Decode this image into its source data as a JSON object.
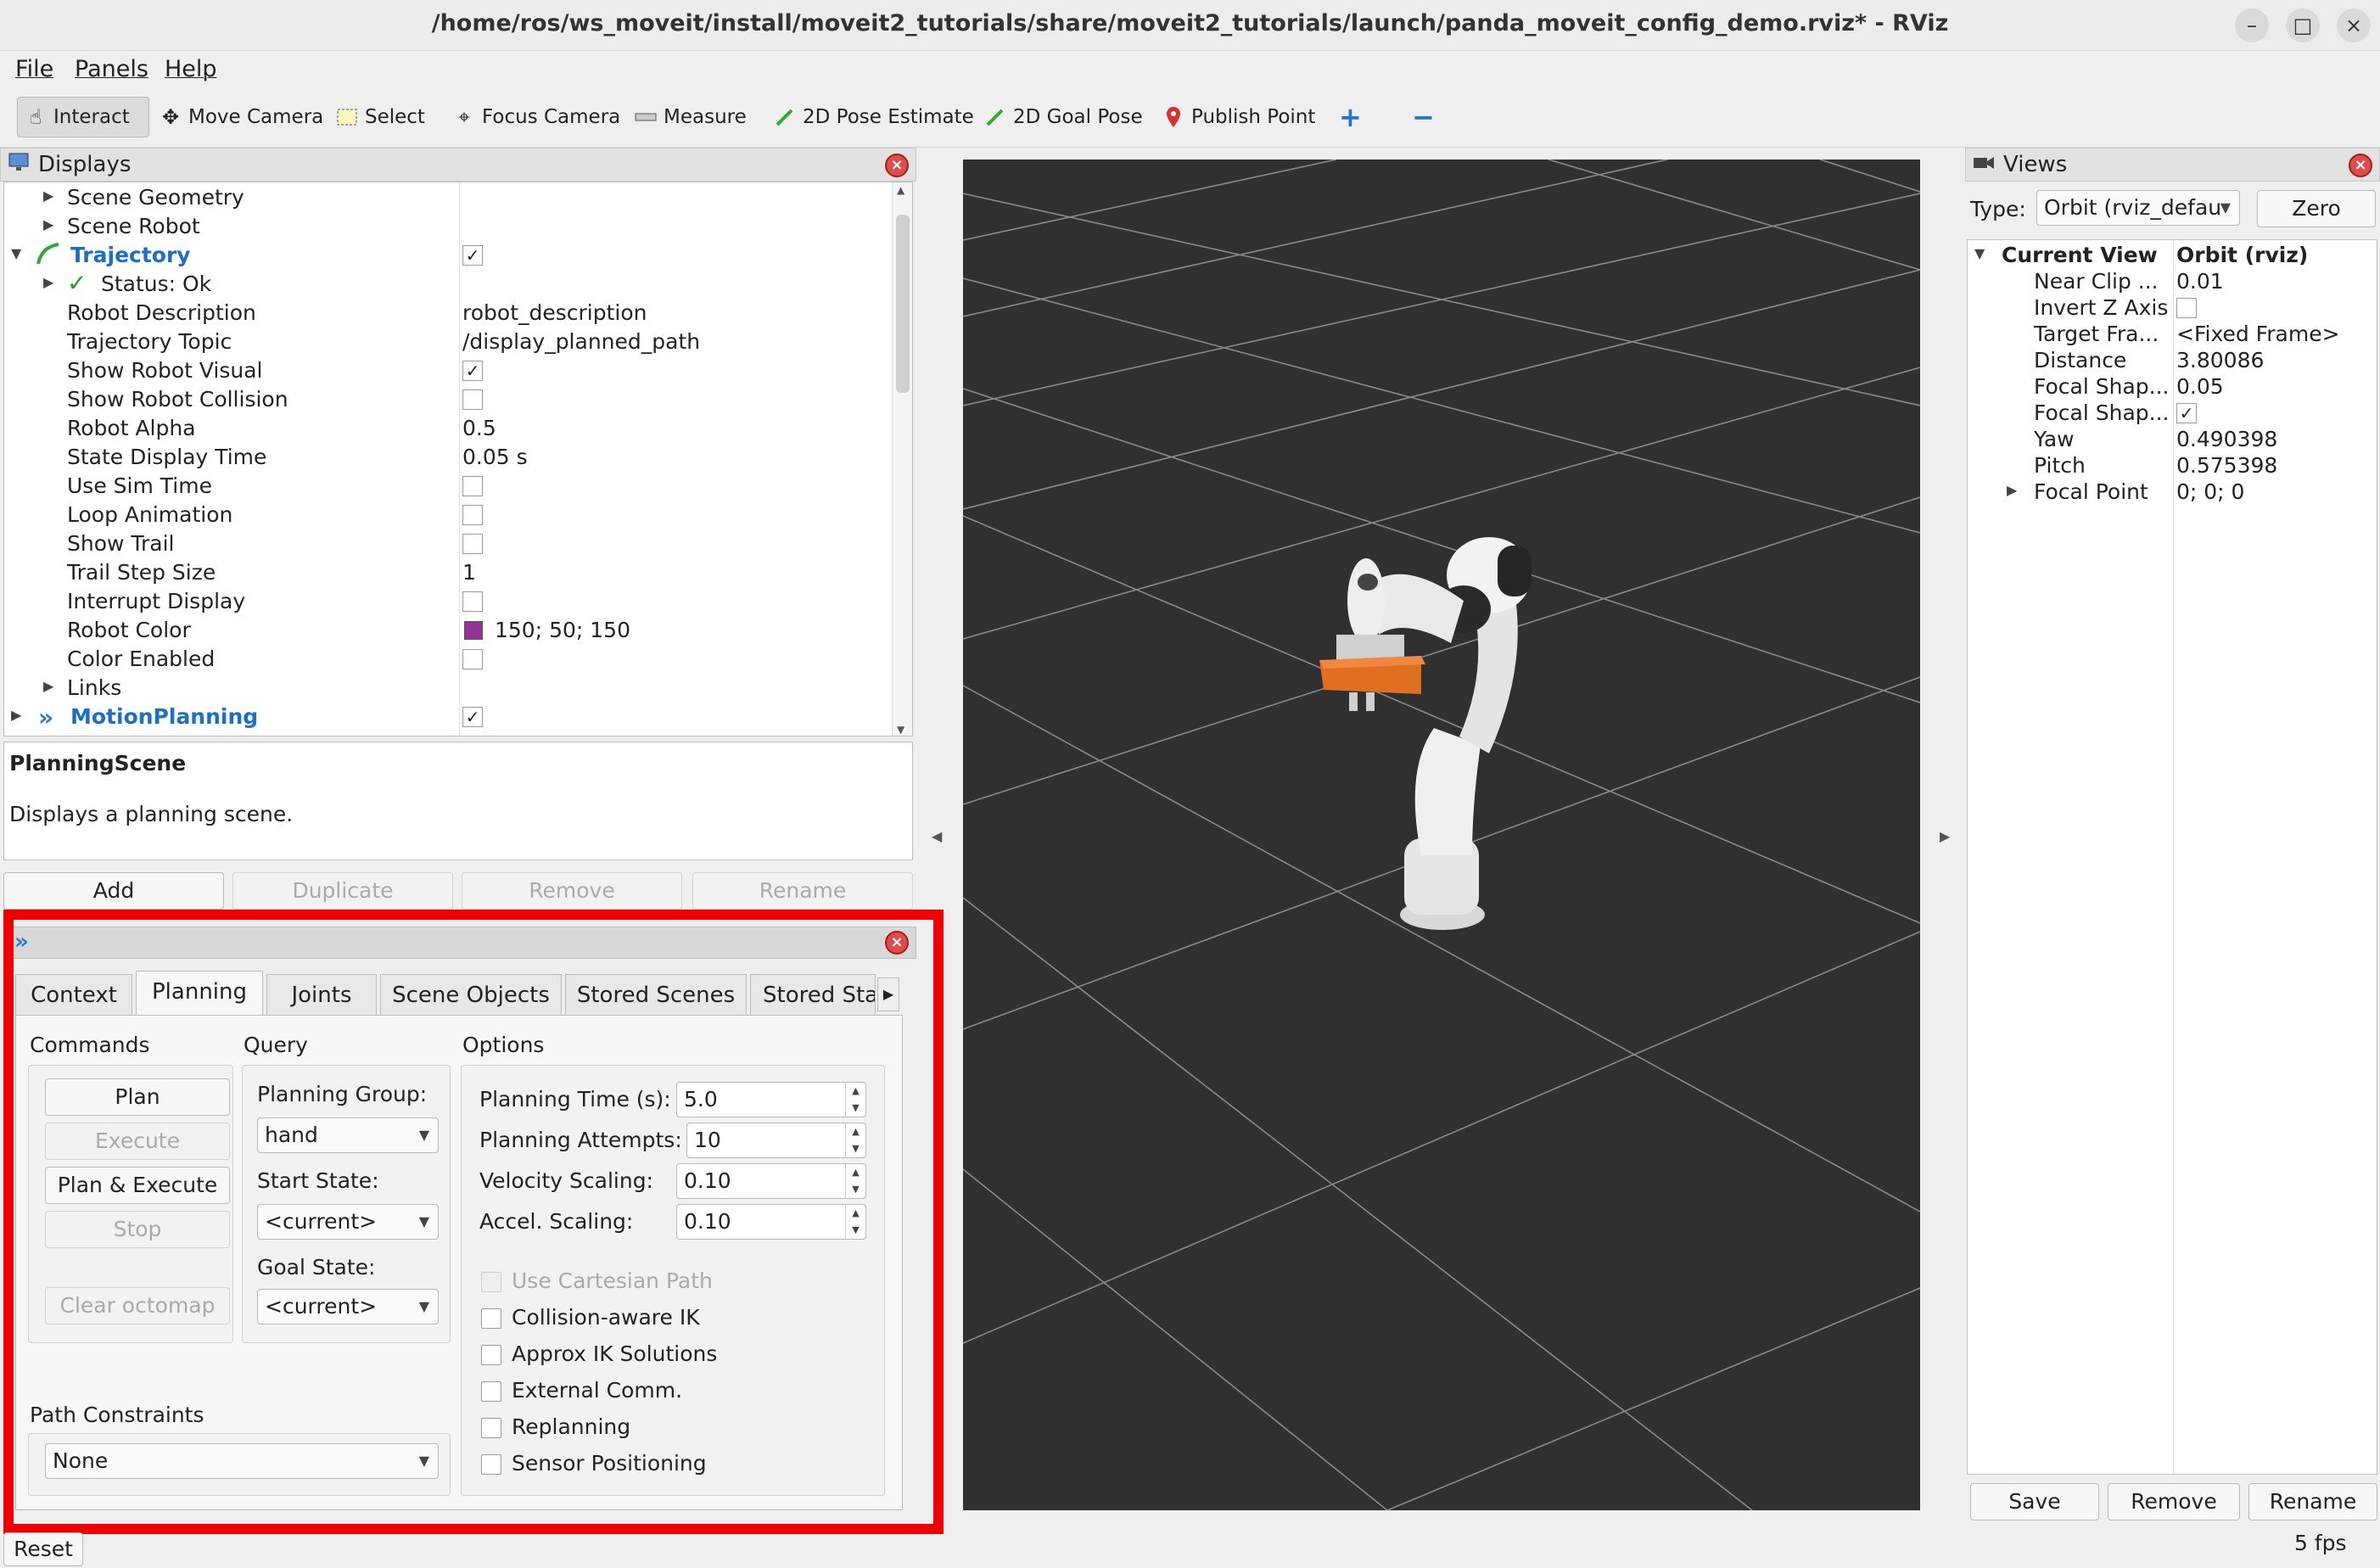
{
  "window": {
    "title": "/home/ros/ws_moveit/install/moveit2_tutorials/share/moveit2_tutorials/launch/panda_moveit_config_demo.rviz* - RViz",
    "minimize": "–",
    "maximize": "□",
    "close": "×"
  },
  "menu": [
    "File",
    "Panels",
    "Help"
  ],
  "toolbar": {
    "interact": "Interact",
    "move_camera": "Move Camera",
    "select": "Select",
    "focus_camera": "Focus Camera",
    "measure": "Measure",
    "pose_estimate": "2D Pose Estimate",
    "goal_pose": "2D Goal Pose",
    "publish_point": "Publish Point",
    "add_tool": "+",
    "remove_tool": "−"
  },
  "displays": {
    "title": "Displays",
    "rows": [
      {
        "name": "Scene Geometry",
        "value": ""
      },
      {
        "name": "Scene Robot",
        "value": ""
      },
      {
        "name": "Trajectory",
        "value": ""
      },
      {
        "name": "Status: Ok",
        "value": ""
      },
      {
        "name": "Robot Description",
        "value": "robot_description"
      },
      {
        "name": "Trajectory Topic",
        "value": "/display_planned_path"
      },
      {
        "name": "Show Robot Visual",
        "value": ""
      },
      {
        "name": "Show Robot Collision",
        "value": ""
      },
      {
        "name": "Robot Alpha",
        "value": "0.5"
      },
      {
        "name": "State Display Time",
        "value": "0.05 s"
      },
      {
        "name": "Use Sim Time",
        "value": ""
      },
      {
        "name": "Loop Animation",
        "value": ""
      },
      {
        "name": "Show Trail",
        "value": ""
      },
      {
        "name": "Trail Step Size",
        "value": "1"
      },
      {
        "name": "Interrupt Display",
        "value": ""
      },
      {
        "name": "Robot Color",
        "value": "150; 50; 150"
      },
      {
        "name": "Color Enabled",
        "value": ""
      },
      {
        "name": "Links",
        "value": ""
      },
      {
        "name": "MotionPlanning",
        "value": ""
      }
    ],
    "robot_color_hex": "#963296",
    "checkmark": "✓",
    "description_title": "PlanningScene",
    "description_text": "Displays a planning scene.",
    "buttons": {
      "add": "Add",
      "duplicate": "Duplicate",
      "remove": "Remove",
      "rename": "Rename"
    }
  },
  "motion_planning": {
    "tabs": [
      "Context",
      "Planning",
      "Joints",
      "Scene Objects",
      "Stored Scenes",
      "Stored Sta"
    ],
    "active_tab": "Planning",
    "commands_label": "Commands",
    "query_label": "Query",
    "options_label": "Options",
    "buttons": {
      "plan": "Plan",
      "execute": "Execute",
      "plan_execute": "Plan & Execute",
      "stop": "Stop",
      "clear_octomap": "Clear octomap"
    },
    "planning_group_label": "Planning Group:",
    "planning_group_value": "hand",
    "start_state_label": "Start State:",
    "start_state_value": "<current>",
    "goal_state_label": "Goal State:",
    "goal_state_value": "<current>",
    "options": {
      "planning_time_label": "Planning Time (s):",
      "planning_time_value": "5.0",
      "planning_attempts_label": "Planning Attempts:",
      "planning_attempts_value": "10",
      "velocity_scaling_label": "Velocity Scaling:",
      "velocity_scaling_value": "0.10",
      "accel_scaling_label": "Accel. Scaling:",
      "accel_scaling_value": "0.10"
    },
    "checkboxes": [
      {
        "label": "Use Cartesian Path",
        "disabled": true
      },
      {
        "label": "Collision-aware IK",
        "disabled": false
      },
      {
        "label": "Approx IK Solutions",
        "disabled": false
      },
      {
        "label": "External Comm.",
        "disabled": false
      },
      {
        "label": "Replanning",
        "disabled": false
      },
      {
        "label": "Sensor Positioning",
        "disabled": false
      }
    ],
    "path_constraints_label": "Path Constraints",
    "path_constraints_value": "None"
  },
  "views": {
    "title": "Views",
    "type_label": "Type:",
    "type_value": "Orbit (rviz_defau",
    "zero": "Zero",
    "rows": [
      {
        "name": "Current View",
        "value": "Orbit (rviz)"
      },
      {
        "name": "Near Clip ...",
        "value": "0.01"
      },
      {
        "name": "Invert Z Axis",
        "value": ""
      },
      {
        "name": "Target Fra...",
        "value": "<Fixed Frame>"
      },
      {
        "name": "Distance",
        "value": "3.80086"
      },
      {
        "name": "Focal Shap...",
        "value": "0.05"
      },
      {
        "name": "Focal Shap...",
        "value": ""
      },
      {
        "name": "Yaw",
        "value": "0.490398"
      },
      {
        "name": "Pitch",
        "value": "0.575398"
      },
      {
        "name": "Focal Point",
        "value": "0; 0; 0"
      }
    ],
    "buttons": {
      "save": "Save",
      "remove": "Remove",
      "rename": "Rename"
    }
  },
  "status": {
    "reset": "Reset",
    "fps": "5 fps"
  },
  "colors": {
    "highlight": "#ee0000",
    "accent_blue": "#1c6fc8",
    "viewport_bg": "#303030",
    "gripper": "#e07020"
  }
}
